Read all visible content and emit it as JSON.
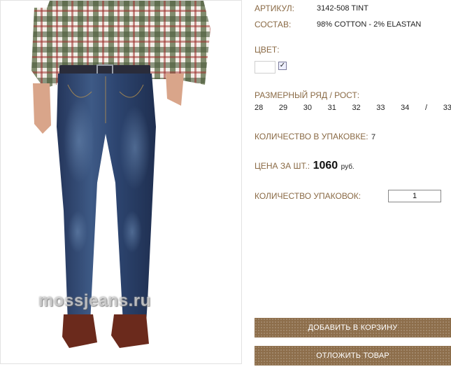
{
  "product": {
    "article_label": "АРТИКУЛ:",
    "article_value": "3142-508 TINT",
    "composition_label": "СОСТАВ:",
    "composition_value": "98% COTTON - 2% ELASTAN",
    "color_label": "ЦВЕТ:",
    "size_label": "РАЗМЕРНЫЙ РЯД / РОСТ:",
    "sizes": [
      "28",
      "29",
      "30",
      "31",
      "32",
      "33",
      "34",
      "/",
      "33"
    ],
    "pack_qty_label": "КОЛИЧЕСТВО В УПАКОВКЕ:",
    "pack_qty_value": "7",
    "price_label": "ЦЕНА ЗА ШТ.:",
    "price_value": "1060",
    "price_currency": "руб.",
    "packs_label": "КОЛИЧЕСТВО УПАКОВОК:",
    "packs_value": "1"
  },
  "photo": {
    "watermark": "mossjeans.ru"
  },
  "actions": {
    "add_to_cart": "ДОБАВИТЬ В КОРЗИНУ",
    "postpone": "ОТЛОЖИТЬ ТОВАР"
  },
  "colors": {
    "label": "#8a6a45",
    "button": "#8d6e4b",
    "denim": "#2b3f63"
  }
}
